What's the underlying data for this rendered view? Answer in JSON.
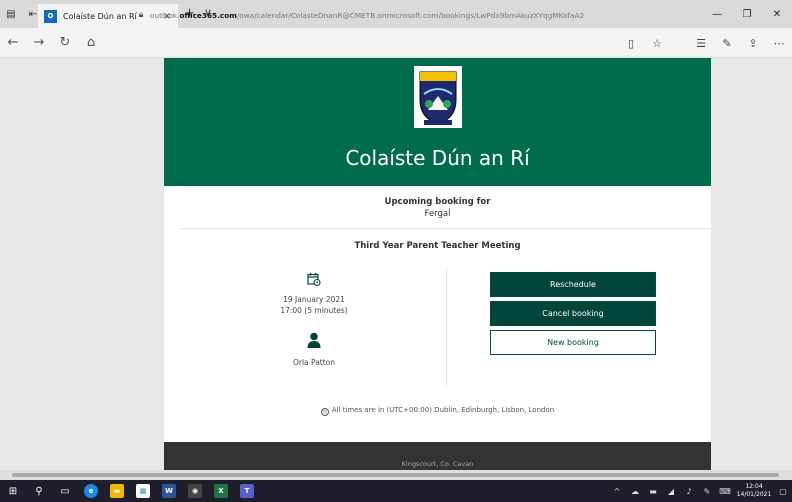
{
  "browser": {
    "tab_title": "Colaíste Dún an Rí",
    "tab_close": "×",
    "new_tab": "+",
    "tab_menu": "∨",
    "url_prefix": "outlook.",
    "url_domain": "office365.com",
    "url_path": "/owa/calendar/ColasteDnanR@CMETB.onmicrosoft.com/bookings/LwPdx9bmAkuzXYqgMKofaA2"
  },
  "page": {
    "school_name": "Colaíste Dún an Rí",
    "upcoming_label": "Upcoming booking for",
    "customer_name": "Fergal",
    "service_name": "Third Year Parent Teacher Meeting",
    "date": "19 January 2021",
    "time": "17:00 (5 minutes)",
    "staff_name": "Orla Patton",
    "reschedule_label": "Reschedule",
    "cancel_label": "Cancel booking",
    "new_booking_label": "New booking",
    "timezone_note": "All times are in (UTC+00:00) Dublin, Edinburgh, Lisbon, London",
    "footer_address": "Kingscourt, Co. Cavan"
  },
  "taskbar": {
    "clock_time": "12:04",
    "clock_date": "14/01/2021"
  },
  "colors": {
    "brand_green": "#006b4d",
    "button_dark": "#00443a",
    "footer_bg": "#333333"
  }
}
